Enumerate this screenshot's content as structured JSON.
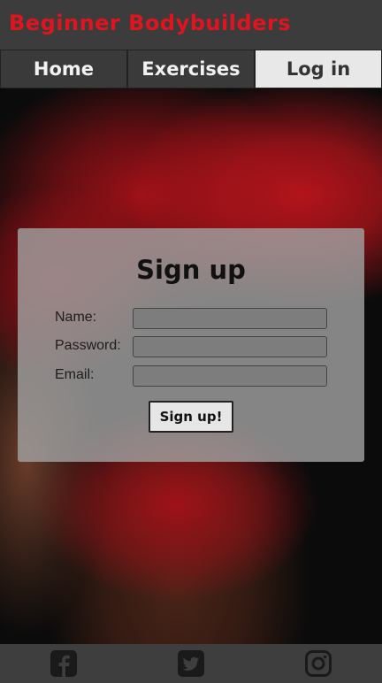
{
  "header": {
    "title": "Beginner Bodybuilders"
  },
  "nav": {
    "items": [
      {
        "label": "Home"
      },
      {
        "label": "Exercises"
      },
      {
        "label": "Log in"
      }
    ]
  },
  "signup": {
    "title": "Sign up",
    "fields": [
      {
        "label": "Name:",
        "value": ""
      },
      {
        "label": "Password:",
        "value": ""
      },
      {
        "label": "Email:",
        "value": ""
      }
    ],
    "button_label": "Sign up!"
  },
  "footer": {
    "icons": [
      "facebook-icon",
      "twitter-icon",
      "instagram-icon"
    ]
  },
  "colors": {
    "brand_red": "#e0141e",
    "header_bg": "#3c3c3c",
    "nav_active_bg": "#e8e8e8",
    "footer_bg": "#3e3e3e"
  }
}
